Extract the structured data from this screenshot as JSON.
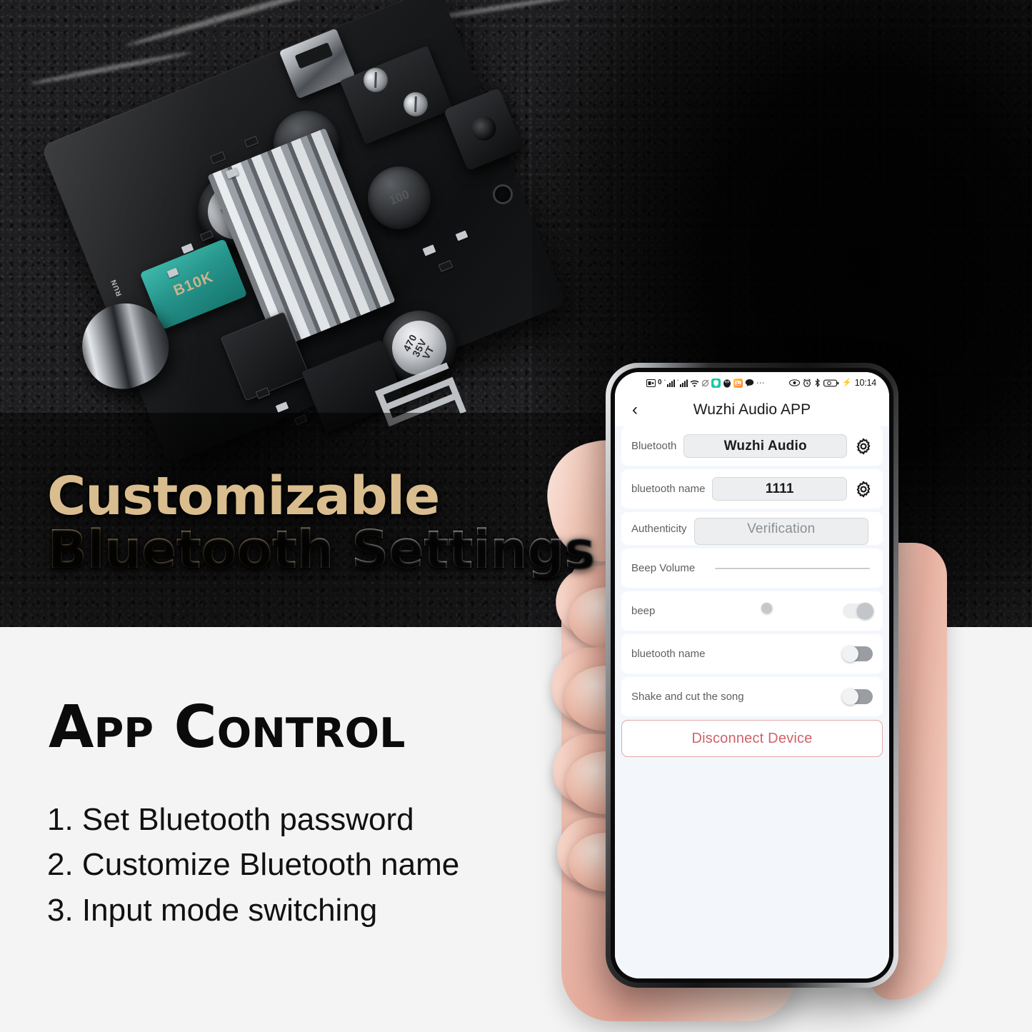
{
  "hero": {
    "headline_line1": "Customizable",
    "headline_line2": "Bluetooth Settings",
    "headline_color_1": "#d9bd8e",
    "headline_color_2": "#ffffff",
    "board": {
      "capacitor_1": "470\n35V\nVT",
      "capacitor_2": "470\n35V\nVT",
      "inductor_1": "100",
      "inductor_2": "100",
      "potentiometer": "B10K",
      "run_label": "RUN"
    }
  },
  "bottom": {
    "title": "App Control",
    "features": [
      "1. Set Bluetooth password",
      "2. Customize Bluetooth name",
      "3. Input mode switching"
    ]
  },
  "phone": {
    "statusbar": {
      "clock": "10:14",
      "left_icons": [
        "sim-card-icon",
        "signal-bars-1-icon",
        "signal-bars-2-icon",
        "wifi-icon",
        "no-sync-icon",
        "shield-app-icon",
        "qq-penguin-icon",
        "gallery-app-icon",
        "message-bubble-icon",
        "more-dots-icon"
      ],
      "right_icons": [
        "eye-icon",
        "alarm-clock-icon",
        "bluetooth-icon",
        "battery-charging-icon"
      ]
    },
    "titlebar": {
      "back_label": "‹",
      "title": "Wuzhi Audio APP"
    },
    "rows": [
      {
        "type": "value",
        "label": "Bluetooth",
        "value": "Wuzhi Audio",
        "muted": false,
        "gear": true
      },
      {
        "type": "value",
        "label": "bluetooth name",
        "value": "1111",
        "muted": false,
        "gear": true
      },
      {
        "type": "value",
        "label": "Authenticity",
        "value": "Verification",
        "muted": true,
        "gear": false
      },
      {
        "type": "slider",
        "label": "Beep Volume",
        "percent": 33
      },
      {
        "type": "toggle",
        "label": "beep",
        "state": "on"
      },
      {
        "type": "toggle",
        "label": "bluetooth name",
        "state": "off"
      },
      {
        "type": "toggle",
        "label": "Shake and cut the song",
        "state": "off"
      }
    ],
    "disconnect_label": "Disconnect Device",
    "accent_red": "#d0626a"
  }
}
